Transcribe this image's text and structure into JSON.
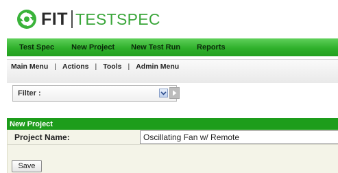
{
  "brand": {
    "name_part1": "FIT",
    "name_part2": "TESTSPEC",
    "icon": "recycle-gear-icon",
    "colors": {
      "dark": "#2a2a2a",
      "green": "#3aa63a"
    }
  },
  "main_nav": {
    "items": [
      {
        "label": "Test Spec"
      },
      {
        "label": "New Project"
      },
      {
        "label": "New Test Run"
      },
      {
        "label": "Reports"
      }
    ],
    "color": "#2fb02b"
  },
  "sub_nav": {
    "items": [
      {
        "label": "Main Menu"
      },
      {
        "label": "Actions"
      },
      {
        "label": "Tools"
      },
      {
        "label": "Admin Menu"
      }
    ],
    "separator": "|"
  },
  "filter": {
    "label": "Filter :",
    "dropdown_icon": "chevron-down-icon",
    "go_icon": "play-arrow-icon"
  },
  "panel": {
    "title": "New Project",
    "title_color": "#1d9d1b",
    "field_label": "Project Name:",
    "field_value": "Oscillating Fan w/ Remote",
    "save_label": "Save"
  }
}
